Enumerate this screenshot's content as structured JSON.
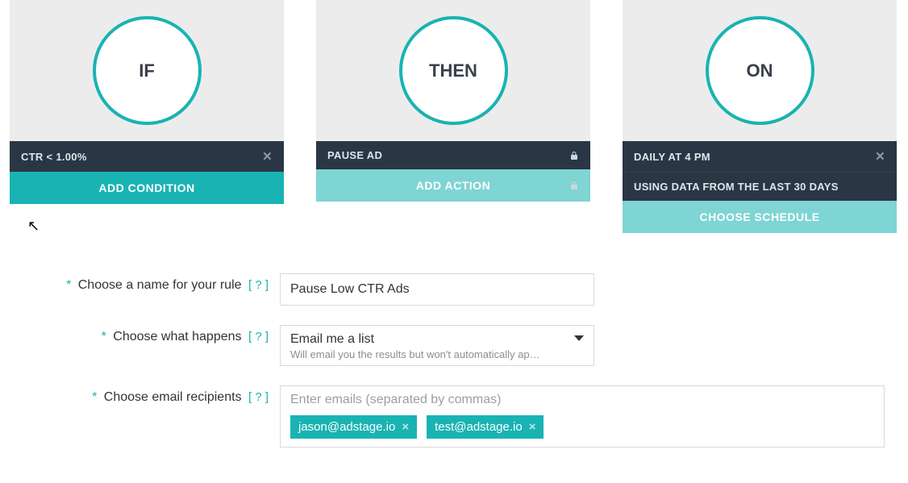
{
  "cards": {
    "if": {
      "title": "IF",
      "bar1": "CTR < 1.00%",
      "button": "ADD CONDITION"
    },
    "then": {
      "title": "THEN",
      "bar1": "PAUSE AD",
      "button": "ADD ACTION"
    },
    "on": {
      "title": "ON",
      "bar1": "DAILY AT 4 PM",
      "bar2": "USING DATA FROM THE LAST 30 DAYS",
      "button": "CHOOSE SCHEDULE"
    }
  },
  "form": {
    "ruleName": {
      "label": "Choose a name for your rule",
      "help": "[ ? ]",
      "value": "Pause Low CTR Ads"
    },
    "whatHappens": {
      "label": "Choose what happens",
      "help": "[ ? ]",
      "value": "Email me a list",
      "hint": "Will email you the results but won't automatically ap…"
    },
    "emailRecipients": {
      "label": "Choose email recipients",
      "help": "[ ? ]",
      "placeholder": "Enter emails (separated by commas)",
      "chips": [
        "jason@adstage.io",
        "test@adstage.io"
      ]
    }
  },
  "colors": {
    "teal": "#19b3b3",
    "tealLight": "#7fd4d4",
    "barBg": "#2b3645",
    "cardBg": "#ececec"
  }
}
